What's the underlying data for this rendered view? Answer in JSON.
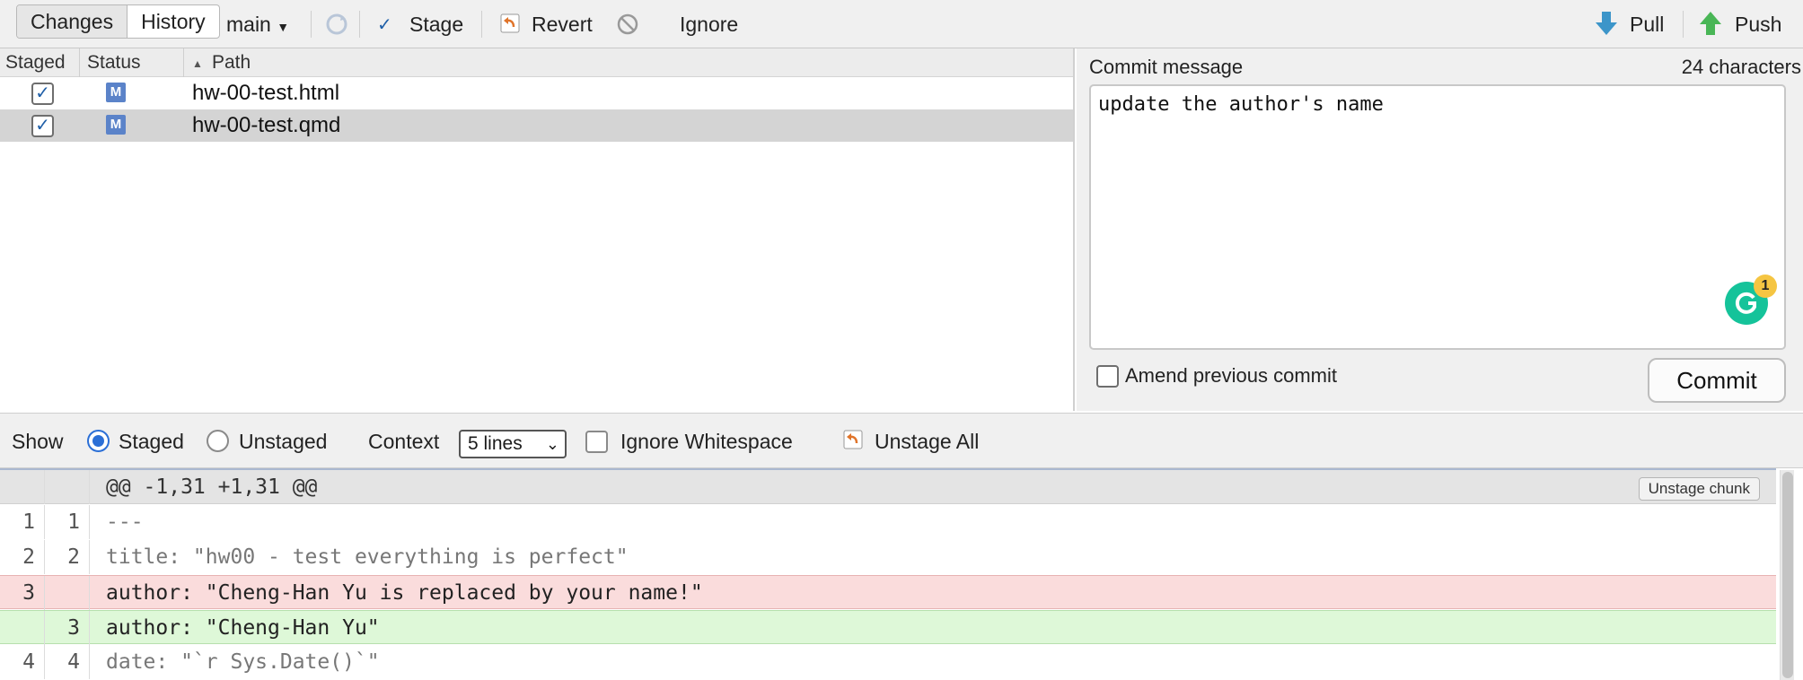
{
  "toolbar": {
    "tab_changes": "Changes",
    "tab_history": "History",
    "branch": "main",
    "stage": "Stage",
    "revert": "Revert",
    "ignore": "Ignore",
    "pull": "Pull",
    "push": "Push"
  },
  "file_list": {
    "columns": [
      "Staged",
      "Status",
      "Path"
    ],
    "files": [
      {
        "staged": true,
        "status": "M",
        "path": "hw-00-test.html",
        "selected": false
      },
      {
        "staged": true,
        "status": "M",
        "path": "hw-00-test.qmd",
        "selected": true
      }
    ]
  },
  "commit": {
    "label": "Commit message",
    "char_count": "24 characters",
    "message": "update the author's name",
    "grammarly_badge": "1",
    "amend_label": "Amend previous commit",
    "amend_checked": false,
    "commit_button": "Commit"
  },
  "options": {
    "show_label": "Show",
    "staged_label": "Staged",
    "unstaged_label": "Unstaged",
    "show_selected": "Staged",
    "context_label": "Context",
    "context_value": "5 lines",
    "ignore_ws_label": "Ignore Whitespace",
    "ignore_ws_checked": false,
    "unstage_all": "Unstage All"
  },
  "diff": {
    "hunk_header": "@@ -1,31 +1,31 @@",
    "unstage_chunk": "Unstage chunk",
    "lines": [
      {
        "old": "1",
        "new": "1",
        "type": "context",
        "text": "---"
      },
      {
        "old": "2",
        "new": "2",
        "type": "context",
        "text": "title: \"hw00 - test everything is perfect\""
      },
      {
        "old": "3",
        "new": "",
        "type": "removed",
        "text": "author: \"Cheng-Han Yu is replaced by your name!\""
      },
      {
        "old": "",
        "new": "3",
        "type": "added",
        "text": "author: \"Cheng-Han Yu\""
      },
      {
        "old": "4",
        "new": "4",
        "type": "context",
        "text": "date: \"`r Sys.Date()`\""
      }
    ]
  },
  "colors": {
    "removed_bg": "#fadcdc",
    "added_bg": "#def8d8",
    "hunk_bg": "#e4e4e4",
    "accent": "#2b6fd6"
  }
}
